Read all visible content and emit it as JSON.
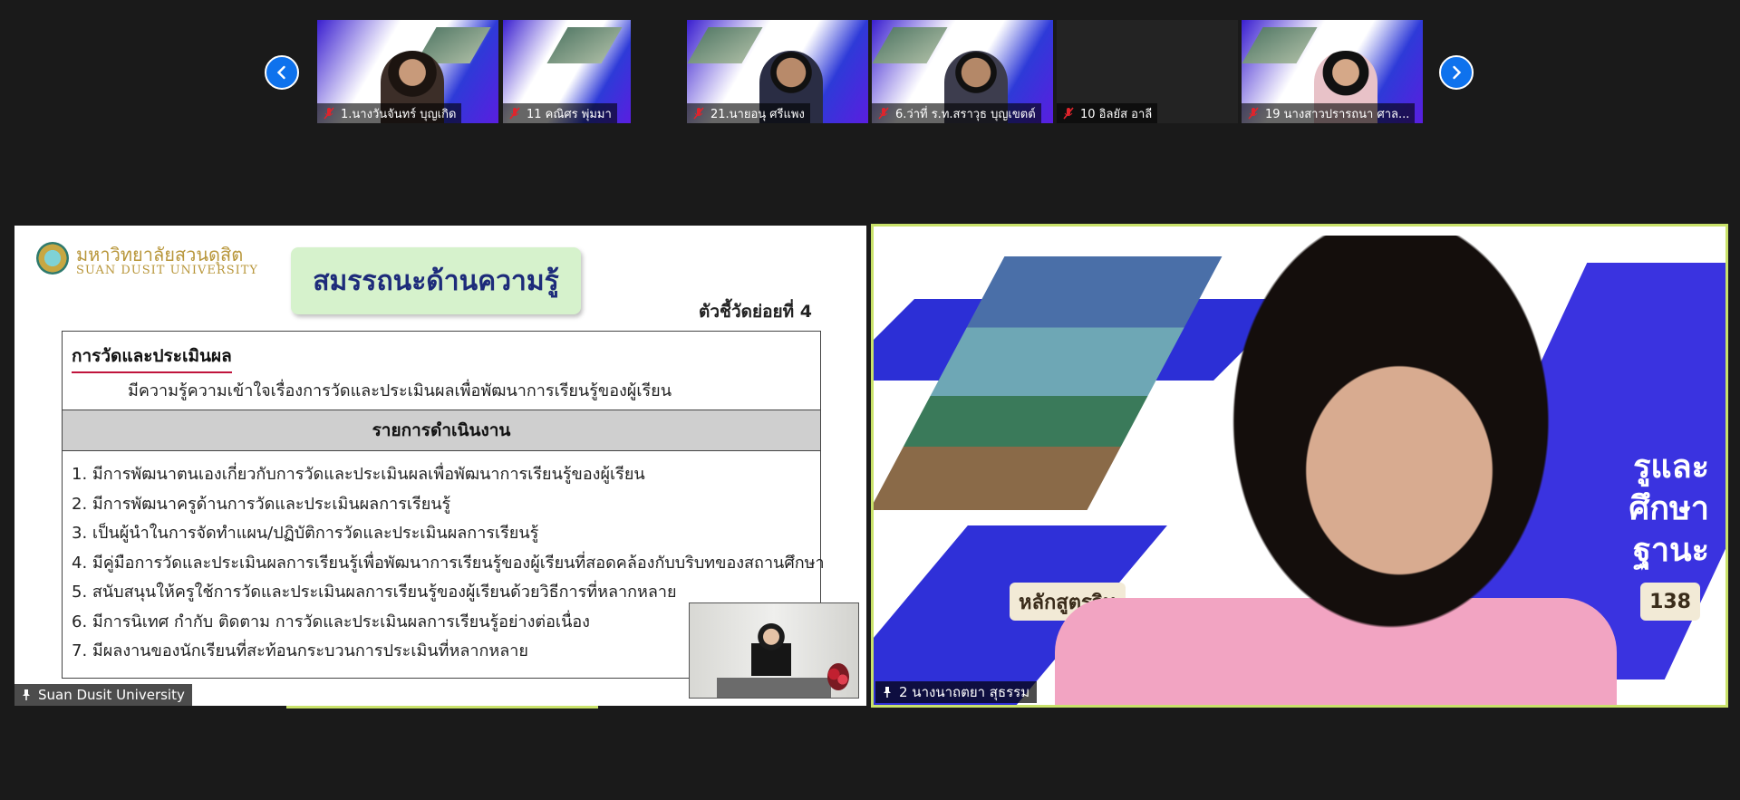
{
  "thumbnails": [
    {
      "name": "1.นางวันจันทร์  บุญเกิด"
    },
    {
      "name": "11 คณิศร  พุ่มมา"
    },
    {
      "name": "21.นายอนุ ศรีแพง"
    },
    {
      "name": "6.ว่าที่ ร.ท.สราวุธ บุญเขตต์"
    },
    {
      "name": "10 อิลยัส อาลี"
    },
    {
      "name": "19 นางสาวปรารถนา ศาล..."
    }
  ],
  "share": {
    "presenter_label": "Suan Dusit University",
    "uni_name_th": "มหาวิทยาลัยสวนดุสิต",
    "uni_name_en": "SUAN DUSIT UNIVERSITY",
    "slide_title": "สมรรถนะด้านความรู้",
    "sub_indicator": "ตัวชี้วัดย่อยที่ 4",
    "heading": "การวัดและประเมินผล",
    "description": "มีความรู้ความเข้าใจเรื่องการวัดและประเมินผลเพื่อพัฒนาการเรียนรู้ของผู้เรียน",
    "table_header": "รายการดำเนินงาน",
    "items": [
      "1. มีการพัฒนาตนเองเกี่ยวกับการวัดและประเมินผลเพื่อพัฒนาการเรียนรู้ของผู้เรียน",
      "2. มีการพัฒนาครูด้านการวัดและประเมินผลการเรียนรู้",
      "3. เป็นผู้นำในการจัดทำแผน/ปฏิบัติการวัดและประเมินผลการเรียนรู้",
      "4. มีคู่มือการวัดและประเมินผลการเรียนรู้เพื่อพัฒนาการเรียนรู้ของผู้เรียนที่สอดคล้องกับบริบทของสถานศึกษา",
      "5. สนับสนุนให้ครูใช้การวัดและประเมินผลการเรียนรู้ของผู้เรียนด้วยวิธีการที่หลากหลาย",
      "6. มีการนิเทศ กำกับ ติดตาม การวัดและประเมินผลการเรียนรู้อย่างต่อเนื่อง",
      "7. มีผลงานของนักเรียนที่สะท้อนกระบวนการประเมินที่หลากหลาย"
    ]
  },
  "speaker": {
    "name": "2 นางนาถตยา สุธรรม",
    "bg_title": "หลักสูตรวิท",
    "bg_number": "138",
    "bg_right_text": [
      "รูและ",
      "ศึกษา",
      "ฐานะ"
    ]
  },
  "colors": {
    "accent_border": "#c9e26a",
    "nav_button": "#0e72ed",
    "mute_red": "#e0242c"
  }
}
